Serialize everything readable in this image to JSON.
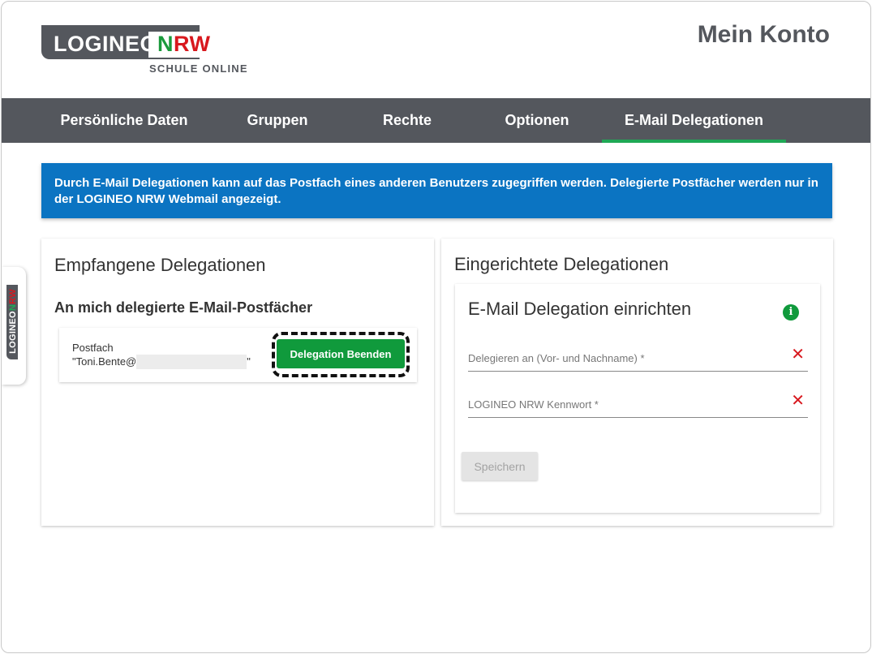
{
  "header": {
    "logo_part1": "LOGINEO",
    "logo_n": "N",
    "logo_r": "R",
    "logo_w": "W",
    "logo_sub": "SCHULE ONLINE",
    "page_title": "Mein Konto"
  },
  "nav": {
    "tabs": [
      {
        "label": "Persönliche Daten"
      },
      {
        "label": "Gruppen"
      },
      {
        "label": "Rechte"
      },
      {
        "label": "Optionen"
      },
      {
        "label": "E-Mail Delegationen"
      }
    ],
    "active_index": 4
  },
  "banner": {
    "text": "Durch E-Mail Delegationen kann auf das Postfach eines anderen Benutzers zugegriffen werden. Delegierte Postfächer werden nur in der LOGINEO NRW Webmail angezeigt."
  },
  "side_tab": {
    "part1": "LOGINEO",
    "part_n": "N",
    "part_rw": "RW"
  },
  "received": {
    "title": "Empfangene Delegationen",
    "subtitle": "An mich delegierte E-Mail-Postfächer",
    "mailbox_label": "Postfach",
    "mailbox_address_prefix": "\"Toni.Bente@",
    "mailbox_address_suffix": "\"",
    "end_button": "Delegation Beenden"
  },
  "configured": {
    "title": "Eingerichtete Delegationen",
    "form_title": "E-Mail Delegation einrichten",
    "info_icon": "i",
    "field_delegate_placeholder": "Delegieren an (Vor- und Nachname) *",
    "field_password_placeholder": "LOGINEO NRW Kennwort *",
    "clear_icon": "✕",
    "save_button": "Speichern"
  },
  "colors": {
    "brand_gray": "#54575d",
    "brand_green": "#1fa855",
    "brand_red": "#d8181e",
    "banner_blue": "#0b74c2",
    "button_green": "#109a3c"
  }
}
